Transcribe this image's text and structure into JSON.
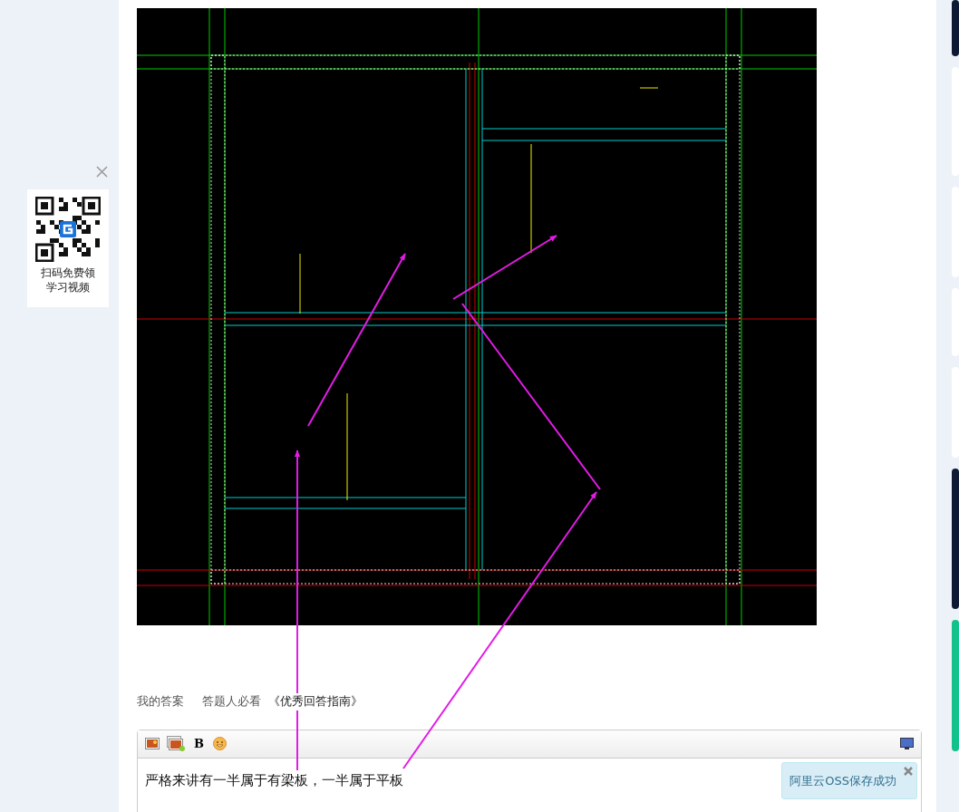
{
  "qr_widget": {
    "caption_lines": [
      "扫码免费领",
      "学习视频"
    ]
  },
  "answer_links": [
    {
      "text": "我的答案",
      "kind": "tab"
    },
    {
      "text": "答题人必看",
      "kind": "tab"
    },
    {
      "text": "《优秀回答指南》",
      "kind": "link"
    }
  ],
  "editor": {
    "bold_label": "B",
    "value": "严格来讲有一半属于有梁板，一半属于平板",
    "notice": "阿里云OSS保存成功"
  },
  "side_cards": [
    {
      "color": "#0e1a33"
    },
    {
      "color": "#ffffff"
    },
    {
      "color": "#ffffff"
    },
    {
      "color": "#ffffff"
    },
    {
      "color": "#ffffff"
    },
    {
      "color": "#0e1a33"
    },
    {
      "color": "#12c28a"
    }
  ]
}
